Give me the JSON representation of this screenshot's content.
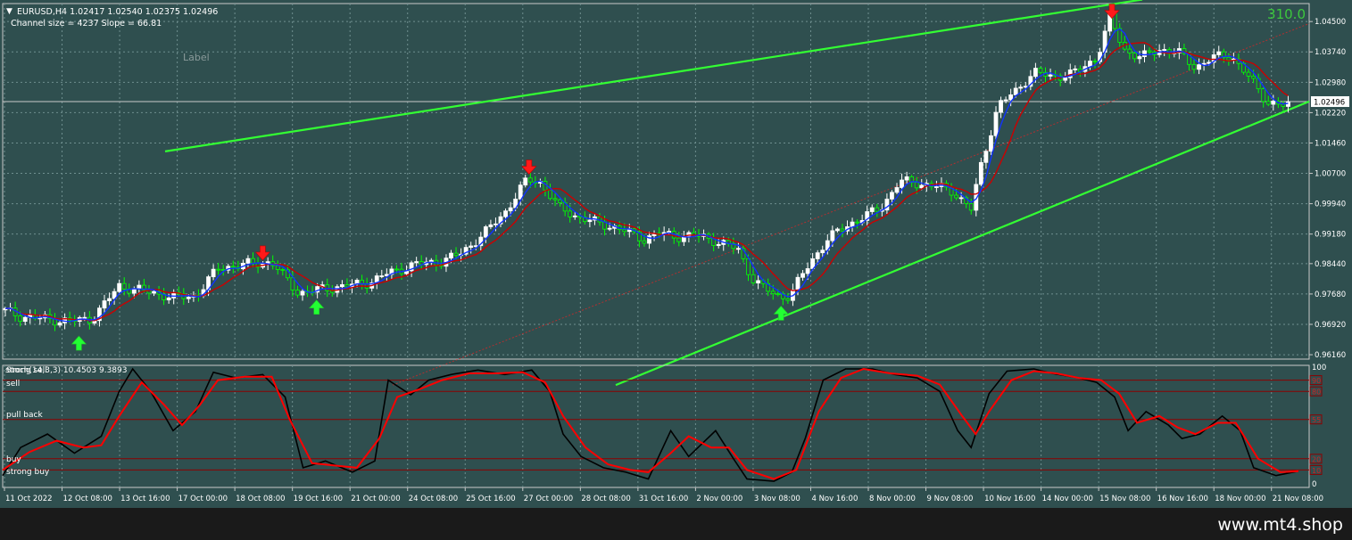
{
  "header": {
    "symbol_line": "EURUSD,H4  1.02417 1.02540 1.02375 1.02496",
    "channel_info": "Channel size = 4237 Slope = 66.81",
    "spread_value": "310.0",
    "label_text": "Label"
  },
  "current_price_label": "1.02496",
  "stoch_header": "Stoch(14,3,3) 10.4503 9.3893",
  "stoch_overlap_text": "strong sell",
  "zone_labels": [
    "sell",
    "pull back",
    "buy",
    "strong buy"
  ],
  "watermark": "www.mt4.shop",
  "colors": {
    "background": "#2f4f4f",
    "grid": "#6f8f8f",
    "bull_candle": "#ffffff",
    "bear_candle": "#00ff00",
    "channel": "#33ff33",
    "ma_blue": "#1133ff",
    "ma_red": "#cc0000",
    "stoch_main": "#000000",
    "stoch_signal": "#ff0000",
    "level_line": "#8b0000"
  },
  "chart_data": [
    {
      "type": "candlestick",
      "title": "EURUSD,H4",
      "y_ticks": [
        "1.04500",
        "1.03740",
        "1.02980",
        "1.02220",
        "1.01460",
        "1.00700",
        "0.99940",
        "0.99180",
        "0.98440",
        "0.97680",
        "0.96920",
        "0.96160"
      ],
      "ylim": [
        0.9605,
        1.0495
      ],
      "x_ticks": [
        "11 Oct 2022",
        "12 Oct 08:00",
        "13 Oct 16:00",
        "17 Oct 00:00",
        "18 Oct 08:00",
        "19 Oct 16:00",
        "21 Oct 00:00",
        "24 Oct 08:00",
        "25 Oct 16:00",
        "27 Oct 00:00",
        "28 Oct 08:00",
        "31 Oct 16:00",
        "2 Nov 00:00",
        "3 Nov 08:00",
        "4 Nov 16:00",
        "8 Nov 00:00",
        "9 Nov 08:00",
        "10 Nov 16:00",
        "14 Nov 00:00",
        "15 Nov 08:00",
        "16 Nov 16:00",
        "18 Nov 00:00",
        "21 Nov 08:00"
      ],
      "close_path": [
        [
          0,
          0.9728
        ],
        [
          0.02,
          0.9712
        ],
        [
          0.05,
          0.9705
        ],
        [
          0.075,
          0.97
        ],
        [
          0.1,
          0.9706
        ],
        [
          0.13,
          0.9788
        ],
        [
          0.16,
          0.9775
        ],
        [
          0.19,
          0.976
        ],
        [
          0.215,
          0.9762
        ],
        [
          0.24,
          0.9832
        ],
        [
          0.27,
          0.9842
        ],
        [
          0.3,
          0.9848
        ],
        [
          0.33,
          0.977
        ],
        [
          0.36,
          0.9782
        ],
        [
          0.39,
          0.979
        ],
        [
          0.41,
          0.9798
        ],
        [
          0.43,
          0.982
        ],
        [
          0.46,
          0.9842
        ],
        [
          0.49,
          0.985
        ],
        [
          0.51,
          0.9868
        ],
        [
          0.535,
          0.9915
        ],
        [
          0.56,
          0.9972
        ],
        [
          0.585,
          1.0055
        ],
        [
          0.6,
          1.0048
        ],
        [
          0.62,
          0.9985
        ],
        [
          0.64,
          0.9962
        ],
        [
          0.66,
          0.9948
        ],
        [
          0.69,
          0.993
        ],
        [
          0.715,
          0.9905
        ],
        [
          0.73,
          0.992
        ],
        [
          0.75,
          0.9912
        ],
        [
          0.77,
          0.9915
        ],
        [
          0.79,
          0.9905
        ],
        [
          0.82,
          0.988
        ],
        [
          0.835,
          0.981
        ],
        [
          0.85,
          0.978
        ],
        [
          0.868,
          0.976
        ],
        [
          0.878,
          0.9765
        ],
        [
          0.9,
          0.9845
        ],
        [
          0.92,
          0.9905
        ],
        [
          0.94,
          0.9938
        ],
        [
          0.96,
          0.996
        ],
        [
          0.98,
          0.9985
        ],
        [
          1.0,
          1.005
        ],
        [
          1.02,
          1.0045
        ],
        [
          1.04,
          1.0038
        ],
        [
          1.06,
          1.0025
        ],
        [
          1.08,
          0.998
        ],
        [
          1.09,
          1.008
        ],
        [
          1.11,
          1.024
        ],
        [
          1.13,
          1.0275
        ],
        [
          1.15,
          1.0325
        ],
        [
          1.17,
          1.031
        ],
        [
          1.2,
          1.0325
        ],
        [
          1.22,
          1.036
        ],
        [
          1.235,
          1.046
        ],
        [
          1.25,
          1.038
        ],
        [
          1.27,
          1.036
        ],
        [
          1.29,
          1.038
        ],
        [
          1.31,
          1.0375
        ],
        [
          1.33,
          1.0335
        ],
        [
          1.35,
          1.036
        ],
        [
          1.37,
          1.0365
        ],
        [
          1.39,
          1.031
        ],
        [
          1.41,
          1.025
        ],
        [
          1.43,
          1.0238
        ],
        [
          1.445,
          1.0249
        ]
      ],
      "channel": {
        "upper": [
          1.0125,
          1.0505
        ],
        "middle": [
          0.954,
          1.0445
        ],
        "lower": [
          0.954,
          1.025
        ]
      },
      "up_arrows": [
        [
          0.085,
          0.9645
        ],
        [
          0.35,
          0.9735
        ],
        [
          0.868,
          0.972
        ]
      ],
      "down_arrows": [
        [
          0.29,
          0.9875
        ],
        [
          0.587,
          1.009
        ],
        [
          1.237,
          1.048
        ]
      ],
      "current_price": 1.02496
    },
    {
      "type": "line",
      "title": "Stoch(14,3,3)",
      "series": [
        {
          "name": "main",
          "points": [
            [
              0,
              5
            ],
            [
              0.02,
              30
            ],
            [
              0.05,
              42
            ],
            [
              0.08,
              25
            ],
            [
              0.11,
              40
            ],
            [
              0.13,
              80
            ],
            [
              0.145,
              100
            ],
            [
              0.165,
              80
            ],
            [
              0.19,
              45
            ],
            [
              0.215,
              62
            ],
            [
              0.235,
              97
            ],
            [
              0.26,
              92
            ],
            [
              0.29,
              95
            ],
            [
              0.315,
              75
            ],
            [
              0.335,
              12
            ],
            [
              0.36,
              18
            ],
            [
              0.39,
              8
            ],
            [
              0.415,
              18
            ],
            [
              0.43,
              90
            ],
            [
              0.455,
              77
            ],
            [
              0.475,
              90
            ],
            [
              0.5,
              95
            ],
            [
              0.53,
              99
            ],
            [
              0.56,
              95
            ],
            [
              0.59,
              99
            ],
            [
              0.61,
              80
            ],
            [
              0.625,
              42
            ],
            [
              0.645,
              22
            ],
            [
              0.67,
              12
            ],
            [
              0.695,
              8
            ],
            [
              0.72,
              2
            ],
            [
              0.745,
              45
            ],
            [
              0.765,
              22
            ],
            [
              0.795,
              45
            ],
            [
              0.815,
              20
            ],
            [
              0.83,
              2
            ],
            [
              0.86,
              0
            ],
            [
              0.88,
              8
            ],
            [
              0.895,
              38
            ],
            [
              0.915,
              90
            ],
            [
              0.94,
              100
            ],
            [
              0.97,
              100
            ],
            [
              0.995,
              95
            ],
            [
              1.02,
              92
            ],
            [
              1.045,
              80
            ],
            [
              1.065,
              45
            ],
            [
              1.08,
              30
            ],
            [
              1.1,
              78
            ],
            [
              1.12,
              98
            ],
            [
              1.15,
              100
            ],
            [
              1.17,
              96
            ],
            [
              1.2,
              92
            ],
            [
              1.22,
              88
            ],
            [
              1.24,
              75
            ],
            [
              1.255,
              45
            ],
            [
              1.275,
              62
            ],
            [
              1.3,
              50
            ],
            [
              1.315,
              38
            ],
            [
              1.335,
              42
            ],
            [
              1.36,
              58
            ],
            [
              1.38,
              45
            ],
            [
              1.395,
              12
            ],
            [
              1.42,
              5
            ],
            [
              1.445,
              9
            ]
          ]
        },
        {
          "name": "signal",
          "points": [
            [
              0,
              10
            ],
            [
              0.03,
              26
            ],
            [
              0.06,
              36
            ],
            [
              0.09,
              30
            ],
            [
              0.11,
              32
            ],
            [
              0.13,
              58
            ],
            [
              0.155,
              88
            ],
            [
              0.18,
              68
            ],
            [
              0.2,
              50
            ],
            [
              0.22,
              68
            ],
            [
              0.24,
              90
            ],
            [
              0.27,
              93
            ],
            [
              0.3,
              93
            ],
            [
              0.32,
              55
            ],
            [
              0.345,
              16
            ],
            [
              0.37,
              14
            ],
            [
              0.395,
              12
            ],
            [
              0.42,
              38
            ],
            [
              0.44,
              75
            ],
            [
              0.465,
              82
            ],
            [
              0.49,
              90
            ],
            [
              0.52,
              96
            ],
            [
              0.55,
              96
            ],
            [
              0.58,
              97
            ],
            [
              0.605,
              88
            ],
            [
              0.625,
              58
            ],
            [
              0.65,
              30
            ],
            [
              0.675,
              15
            ],
            [
              0.7,
              10
            ],
            [
              0.72,
              8
            ],
            [
              0.745,
              25
            ],
            [
              0.765,
              40
            ],
            [
              0.79,
              30
            ],
            [
              0.81,
              30
            ],
            [
              0.83,
              10
            ],
            [
              0.86,
              2
            ],
            [
              0.885,
              10
            ],
            [
              0.91,
              62
            ],
            [
              0.935,
              92
            ],
            [
              0.96,
              100
            ],
            [
              0.99,
              96
            ],
            [
              1.02,
              94
            ],
            [
              1.045,
              86
            ],
            [
              1.07,
              58
            ],
            [
              1.085,
              42
            ],
            [
              1.1,
              62
            ],
            [
              1.125,
              90
            ],
            [
              1.15,
              98
            ],
            [
              1.175,
              96
            ],
            [
              1.2,
              92
            ],
            [
              1.225,
              90
            ],
            [
              1.245,
              78
            ],
            [
              1.265,
              52
            ],
            [
              1.29,
              58
            ],
            [
              1.31,
              48
            ],
            [
              1.33,
              42
            ],
            [
              1.355,
              52
            ],
            [
              1.375,
              52
            ],
            [
              1.4,
              20
            ],
            [
              1.425,
              8
            ],
            [
              1.445,
              9
            ]
          ]
        }
      ],
      "levels": [
        10,
        20,
        55,
        80,
        90
      ],
      "axis_labels": [
        "100",
        "0"
      ],
      "ylim": [
        0,
        100
      ]
    }
  ]
}
